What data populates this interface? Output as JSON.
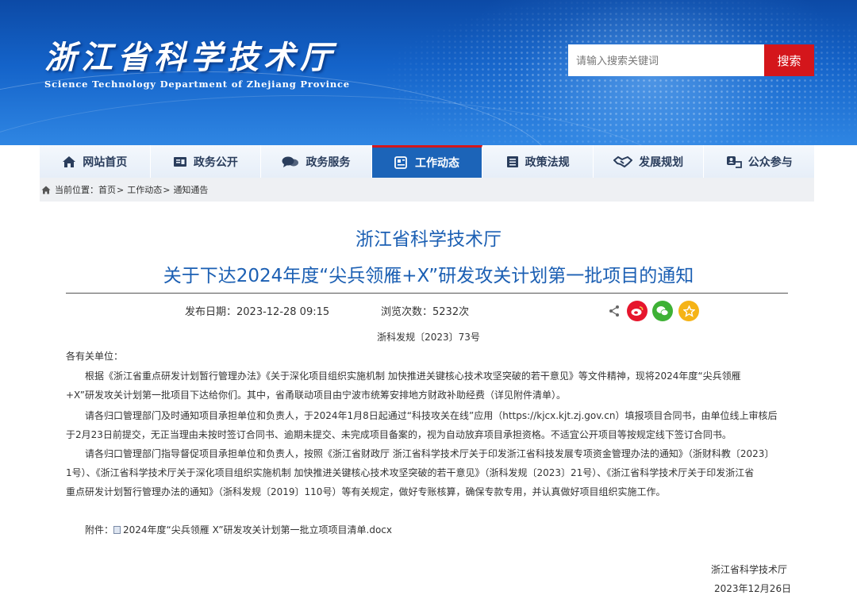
{
  "header": {
    "site_title": "浙江省科学技术厅",
    "site_subtitle": "Science Technology Department of Zhejiang Province",
    "search_placeholder": "请输入搜索关键词",
    "search_button": "搜索"
  },
  "nav": {
    "items": [
      {
        "label": "网站首页",
        "icon": "home-icon"
      },
      {
        "label": "政务公开",
        "icon": "open-book-icon"
      },
      {
        "label": "政务服务",
        "icon": "chat-bubbles-icon"
      },
      {
        "label": "工作动态",
        "icon": "news-icon"
      },
      {
        "label": "政策法规",
        "icon": "document-list-icon"
      },
      {
        "label": "发展规划",
        "icon": "handshake-icon"
      },
      {
        "label": "公众参与",
        "icon": "people-icon"
      }
    ],
    "active": "工作动态"
  },
  "breadcrumb": {
    "prefix": "当前位置：",
    "items": [
      "首页",
      "工作动态",
      "通知通告"
    ],
    "separator": ">"
  },
  "article": {
    "title_line1": "浙江省科学技术厅",
    "title_line2": "关于下达2024年度“尖兵领雁+X”研发攻关计划第一批项目的通知",
    "publish_date_label": "发布日期：2023-12-28 09:15",
    "views_label": "浏览次数：5232次",
    "doc_number": "浙科发规〔2023〕73号",
    "salutation": "各有关单位：",
    "p1_line1": "根据《浙江省重点研发计划暂行管理办法》《关于深化项目组织实施机制 加快推进关键核心技术攻坚突破的若干意见》等文件精神，现将2024年度“尖兵领雁",
    "p1_line2": "+X”研发攻关计划第一批项目下达给你们。其中，省甬联动项目由宁波市统筹安排地方财政补助经费（详见附件清单）。",
    "p2_line1": "请各归口管理部门及时通知项目承担单位和负责人，于2024年1月8日起通过“科技攻关在线”应用（https://kjcx.kjt.zj.gov.cn）填报项目合同书，由单位线上审核后",
    "p2_line2": "于2月23日前提交，无正当理由未按时签订合同书、逾期未提交、未完成项目备案的，视为自动放弃项目承担资格。不适宜公开项目等按规定线下签订合同书。",
    "p3_line1": "请各归口管理部门指导督促项目承担单位和负责人，按照《浙江省财政厅 浙江省科学技术厅关于印发浙江省科技发展专项资金管理办法的通知》（浙财科教〔2023〕",
    "p3_line2": "1号）、《浙江省科学技术厅关于深化项目组织实施机制 加快推进关键核心技术攻坚突破的若干意见》（浙科发规〔2023〕21号）、《浙江省科学技术厅关于印发浙江省",
    "p3_line3": "重点研发计划暂行管理办法的通知》（浙科发规〔2019〕110号）等有关规定，做好专账核算，确保专款专用，并认真做好项目组织实施工作。",
    "attachment_label": "附件：",
    "attachment_name": "2024年度“尖兵领雁 X”研发攻关计划第一批立项项目清单.docx",
    "signature": "浙江省科学技术厅",
    "sign_date": "2023年12月26日"
  },
  "share": {
    "weibo_color": "#e6162d",
    "wechat_color": "#3eb135",
    "favorite_color": "#f5b316"
  }
}
